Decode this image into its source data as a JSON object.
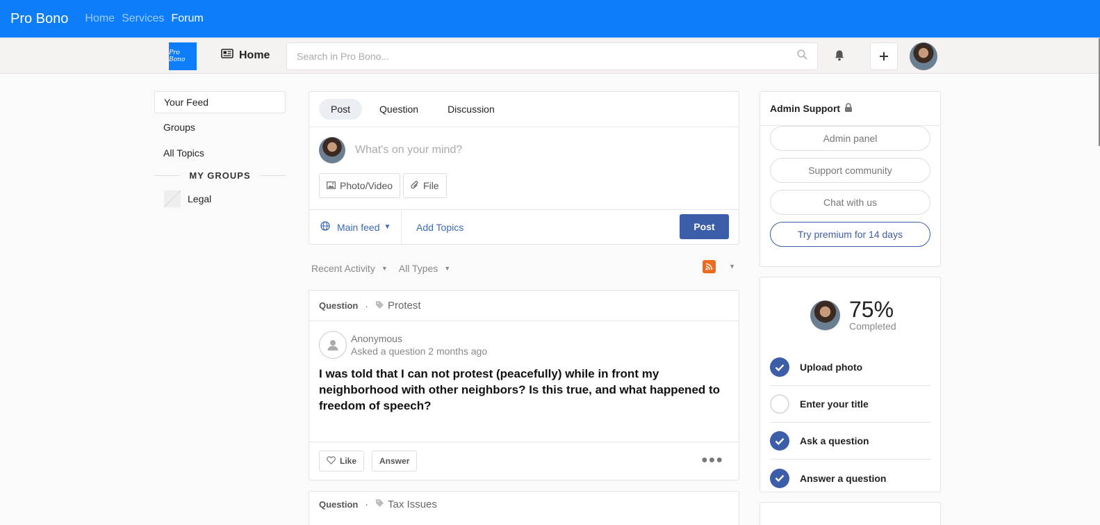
{
  "topnav": {
    "brand": "Pro Bono",
    "links": [
      "Home",
      "Services",
      "Forum"
    ],
    "active": "Forum"
  },
  "header": {
    "logo_text": "Pro Bono",
    "home_label": "Home",
    "search_placeholder": "Search in Pro Bono...",
    "icons": [
      "newspaper-icon",
      "search-icon",
      "bell-icon",
      "plus-icon"
    ]
  },
  "sidebar": {
    "items": [
      "Your Feed",
      "Groups",
      "All Topics"
    ],
    "groups_heading": "MY GROUPS",
    "groups": [
      "Legal"
    ]
  },
  "composer": {
    "tabs": [
      "Post",
      "Question",
      "Discussion"
    ],
    "placeholder": "What's on your mind?",
    "photo_video_label": "Photo/Video",
    "file_label": "File",
    "feed_label": "Main feed",
    "add_topics_label": "Add Topics",
    "post_label": "Post"
  },
  "filters": {
    "activity": "Recent Activity",
    "types": "All Types"
  },
  "questions": [
    {
      "type": "Question",
      "separator": "·",
      "topic": "Protest",
      "author": "Anonymous",
      "meta": "Asked a question 2 months ago",
      "title": "I was told that I can not protest (peacefully) while in front my neighborhood with other neighbors? Is this true, and what happened to freedom of speech?",
      "like_label": "Like",
      "answer_label": "Answer"
    },
    {
      "type": "Question",
      "separator": "·",
      "topic": "Tax Issues"
    }
  ],
  "admin": {
    "title": "Admin Support",
    "buttons": [
      "Admin panel",
      "Support community",
      "Chat with us",
      "Try premium for 14 days"
    ]
  },
  "progress": {
    "percent": "75%",
    "label": "Completed",
    "steps": [
      {
        "label": "Upload photo",
        "done": true
      },
      {
        "label": "Enter your title",
        "done": false
      },
      {
        "label": "Ask a question",
        "done": true
      },
      {
        "label": "Answer a question",
        "done": true
      }
    ]
  },
  "colors": {
    "brand_blue": "#0d7df9",
    "button_blue": "#3c5ea8",
    "rss_orange": "#f06a1d"
  }
}
